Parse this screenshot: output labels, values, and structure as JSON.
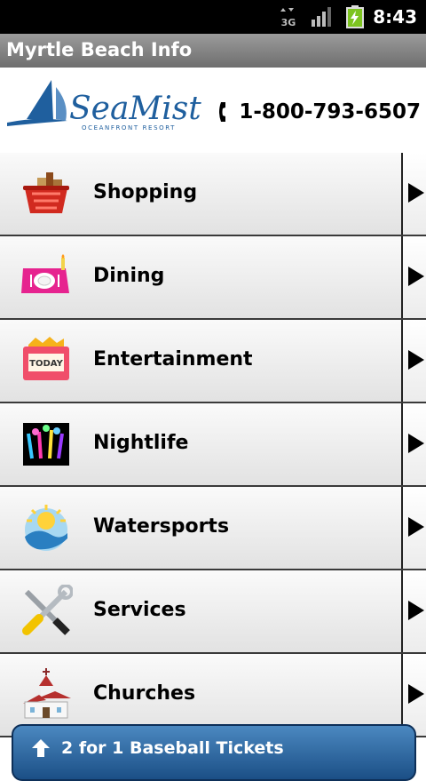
{
  "status_bar": {
    "network": "3G",
    "time": "8:43",
    "icons": [
      "network-3g-icon",
      "signal-icon",
      "battery-charging-icon"
    ]
  },
  "app": {
    "title": "Myrtle Beach Info"
  },
  "header": {
    "logo_name": "SeaMist",
    "logo_tagline": "OCEANFRONT RESORT",
    "phone": "1-800-793-6507"
  },
  "menu": [
    {
      "label": "Shopping",
      "icon": "shopping-basket-icon"
    },
    {
      "label": "Dining",
      "icon": "dining-plate-icon"
    },
    {
      "label": "Entertainment",
      "icon": "marquee-today-icon"
    },
    {
      "label": "Nightlife",
      "icon": "fireworks-icon"
    },
    {
      "label": "Watersports",
      "icon": "sun-wave-icon"
    },
    {
      "label": "Services",
      "icon": "tools-icon"
    },
    {
      "label": "Churches",
      "icon": "church-icon"
    }
  ],
  "banner": {
    "text": "2 for 1 Baseball Tickets",
    "icon": "up-arrow-icon"
  },
  "colors": {
    "title_bar": "#808080",
    "banner": "#2d6aa3",
    "brand_blue": "#1f5f9e"
  }
}
